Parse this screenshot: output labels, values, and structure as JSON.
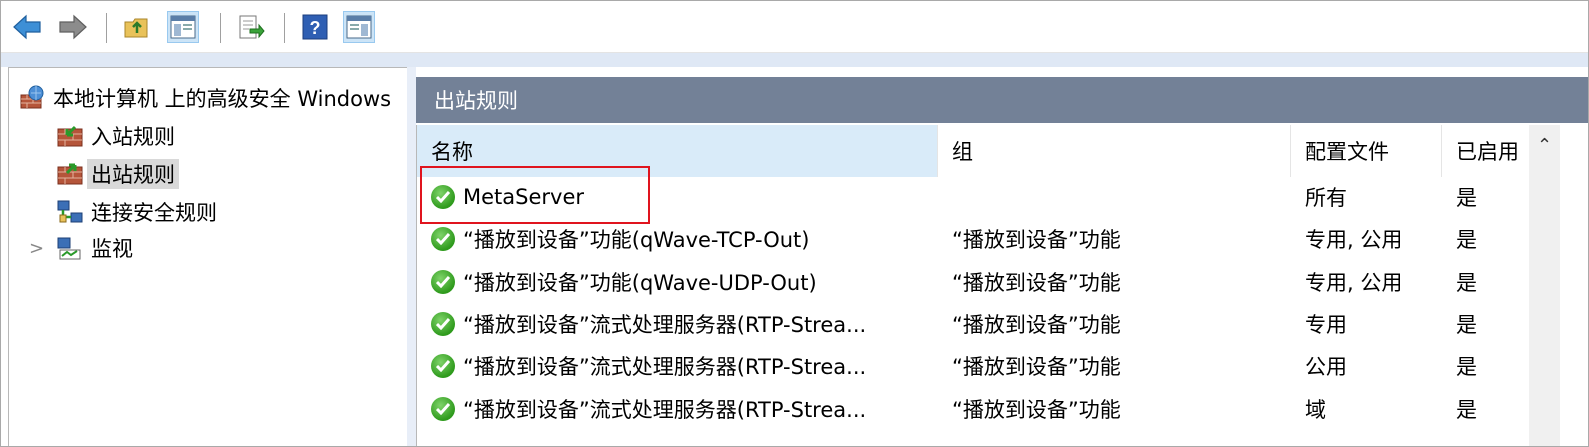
{
  "toolbar": {
    "buttons": [
      {
        "name": "back-button",
        "icon": "arrow-left-icon"
      },
      {
        "name": "forward-button",
        "icon": "arrow-right-icon"
      },
      {
        "name": "up-folder-button",
        "icon": "folder-up-icon"
      },
      {
        "name": "show-hide-console-tree-button",
        "icon": "console-tree-icon"
      },
      {
        "name": "export-list-button",
        "icon": "export-icon"
      },
      {
        "name": "help-button",
        "icon": "help-icon"
      },
      {
        "name": "show-hide-action-pane-button",
        "icon": "action-pane-icon"
      }
    ]
  },
  "tree": {
    "root": "本地计算机 上的高级安全 Windows",
    "items": [
      {
        "label": "入站规则",
        "icon": "inbound-rules-icon"
      },
      {
        "label": "出站规则",
        "icon": "outbound-rules-icon",
        "selected": true
      },
      {
        "label": "连接安全规则",
        "icon": "connection-security-icon"
      },
      {
        "label": "监视",
        "icon": "monitor-icon",
        "expandable": true
      }
    ]
  },
  "pane": {
    "title": "出站规则",
    "columns": [
      "名称",
      "组",
      "配置文件",
      "已启用"
    ],
    "rows": [
      {
        "name": "MetaServer",
        "group": "",
        "profile": "所有",
        "enabled": "是",
        "highlighted": true
      },
      {
        "name": "“播放到设备”功能(qWave-TCP-Out)",
        "group": "“播放到设备”功能",
        "profile": "专用, 公用",
        "enabled": "是"
      },
      {
        "name": "“播放到设备”功能(qWave-UDP-Out)",
        "group": "“播放到设备”功能",
        "profile": "专用, 公用",
        "enabled": "是"
      },
      {
        "name": "“播放到设备”流式处理服务器(RTP-Strea...",
        "group": "“播放到设备”功能",
        "profile": "专用",
        "enabled": "是"
      },
      {
        "name": "“播放到设备”流式处理服务器(RTP-Strea...",
        "group": "“播放到设备”功能",
        "profile": "公用",
        "enabled": "是"
      },
      {
        "name": "“播放到设备”流式处理服务器(RTP-Strea...",
        "group": "“播放到设备”功能",
        "profile": "域",
        "enabled": "是"
      }
    ]
  },
  "colors": {
    "header_bar": "#738197",
    "selected_column": "#d9ebf9",
    "highlight_box": "#e0141e",
    "enabled_check": "#2e9a1c"
  }
}
